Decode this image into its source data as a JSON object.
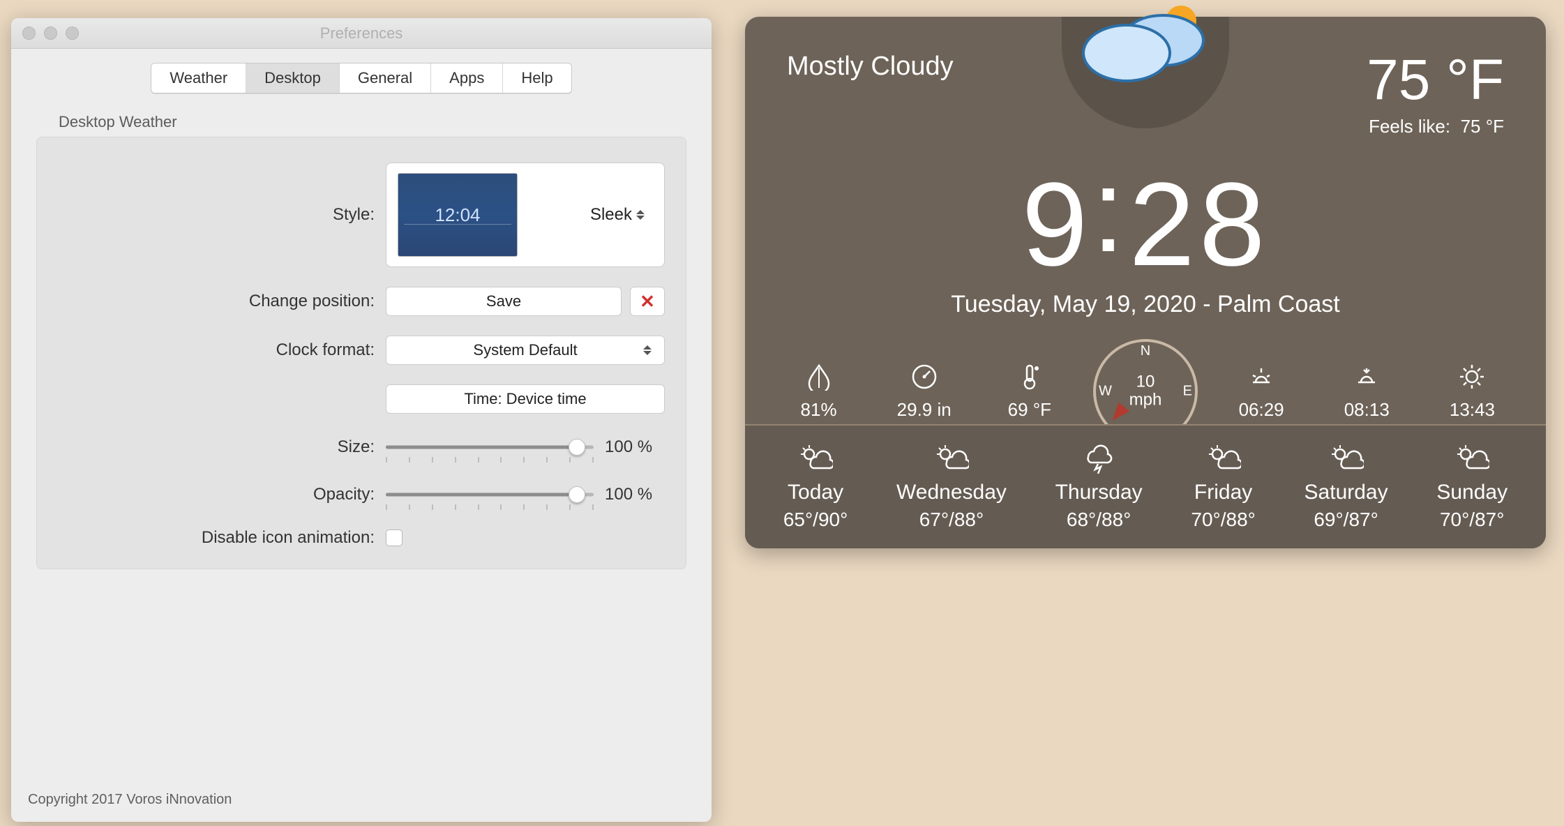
{
  "prefs": {
    "title": "Preferences",
    "tabs": [
      "Weather",
      "Desktop",
      "General",
      "Apps",
      "Help"
    ],
    "active_tab": "Desktop",
    "group_title": "Desktop Weather",
    "style_label": "Style:",
    "style_value": "Sleek",
    "style_thumb_text": "12:04",
    "change_pos_label": "Change position:",
    "save_btn": "Save",
    "clock_format_label": "Clock format:",
    "clock_format_value": "System Default",
    "time_field": "Time: Device time",
    "size_label": "Size:",
    "size_value": "100 %",
    "opacity_label": "Opacity:",
    "opacity_value": "100 %",
    "disable_anim_label": "Disable icon animation:",
    "copyright": "Copyright 2017 Voros iNnovation"
  },
  "widget": {
    "condition": "Mostly Cloudy",
    "temp": "75 °F",
    "feels_label": "Feels like:",
    "feels_value": "75 °F",
    "time_h": "9",
    "time_m": "28",
    "dateline": "Tuesday, May 19, 2020 - Palm Coast",
    "humidity": "81%",
    "pressure": "29.9 in",
    "dewpoint": "69 °F",
    "wind_speed": "10",
    "wind_unit": "mph",
    "sunrise": "06:29",
    "sunset": "08:13",
    "solar_noon": "13:43",
    "forecast": [
      {
        "day": "Today",
        "temps": "65°/90°"
      },
      {
        "day": "Wednesday",
        "temps": "67°/88°"
      },
      {
        "day": "Thursday",
        "temps": "68°/88°"
      },
      {
        "day": "Friday",
        "temps": "70°/88°"
      },
      {
        "day": "Saturday",
        "temps": "69°/87°"
      },
      {
        "day": "Sunday",
        "temps": "70°/87°"
      }
    ]
  }
}
